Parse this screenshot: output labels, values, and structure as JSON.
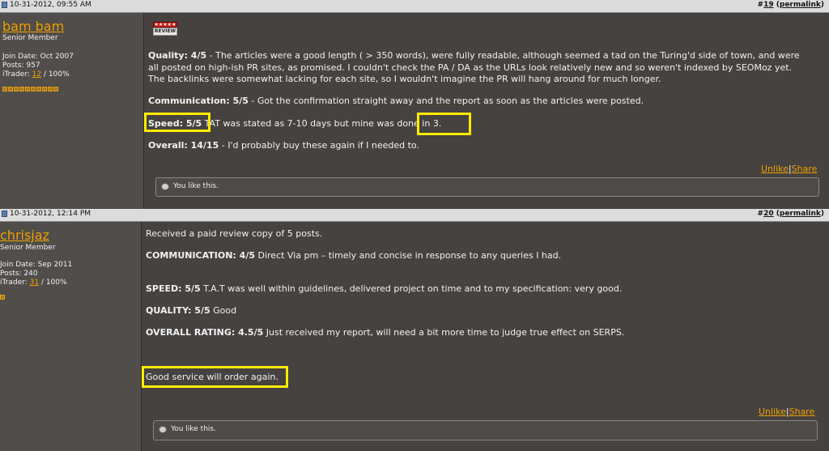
{
  "post19": {
    "date": "10-31-2012, 09:55 AM",
    "number": "#19",
    "num_prefix": "#",
    "num_link": "19",
    "permalink": "permalink",
    "username": "bam bam",
    "user_title": "Senior Member",
    "join": "Join Date: Oct 2007",
    "posts": "Posts: 957",
    "itrader_label": "iTrader:",
    "itrader_count": "12",
    "itrader_pct": "/ 100%",
    "rep_pips": 10,
    "badge": {
      "stars": "★★★★★",
      "label": "REVIEW"
    },
    "quality_label": "Quality: 4/5",
    "quality_line1": " - The articles were a good length ( > 350 words), were fully readable, although seemed a tad on the Turing'd side of town, and were",
    "quality_line2": "all posted on high-ish PR sites, as promised. I couldn't check the PA / DA as the URLs look relatively new and so weren't indexed by SEOMoz yet.",
    "quality_line3": "The backlinks were somewhat lacking for each site, so I wouldn't imagine the PR will hang around for much longer.",
    "comm_label": "Communication: 5/5",
    "comm_text": " - Got the confirmation straight away and the report as soon as the articles were posted.",
    "speed_label": "Speed: 5/5",
    "speed_text": " TAT was stated as 7-10 days but mine was ",
    "speed_done": "done in 3.",
    "overall_label": "Overall: 14/15",
    "overall_text": " - I'd probably buy these again if I needed to.",
    "unlike": "Unlike",
    "share": "Share",
    "sep": "|",
    "you_like": "You like this."
  },
  "post20": {
    "date": "10-31-2012, 12:14 PM",
    "num_prefix": "#",
    "num_link": "20",
    "permalink": "permalink",
    "username": "chrisjaz",
    "user_title": "Senior Member",
    "join": "Join Date: Sep 2011",
    "posts": "Posts: 240",
    "itrader_label": "iTrader:",
    "itrader_count": "31",
    "itrader_pct": "/ 100%",
    "rep_pips": 1,
    "intro": "Received a paid review copy of 5 posts.",
    "comm_label": "COMMUNICATION: 4/5",
    "comm_text": " Direct Via pm – timely and concise in response to any queries I had.",
    "speed_label": "SPEED: 5/5",
    "speed_text": " T.A.T was well within guidelines, delivered project on time and to my specification: very good.",
    "quality_label": "QUALITY: 5/5",
    "quality_text": " Good",
    "overall_label": "OVERALL RATING: 4.5/5",
    "overall_text": " Just received my report, will need a bit more time to judge true effect on SERPS.",
    "closing": "Good service will order again.",
    "unlike": "Unlike",
    "share": "Share",
    "sep": "|",
    "you_like": "You like this."
  },
  "colors": {
    "accent": "#f0a000",
    "highlight": "#ffec00",
    "bg": "#454240",
    "header": "#dcdcdc"
  }
}
